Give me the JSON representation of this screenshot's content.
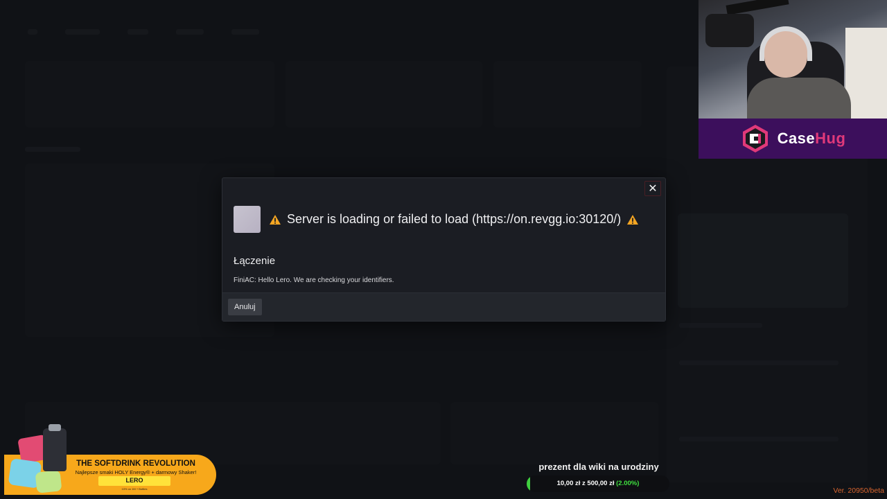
{
  "modal": {
    "title": "Server is loading or failed to load (https://on.revgg.io:30120/)",
    "close_symbol": "✕",
    "status": "Łączenie",
    "message": "FiniAC: Hello Lero. We are checking your identifiers.",
    "cancel_label": "Anuluj",
    "icons": {
      "warning": "warning-triangle-icon",
      "close": "close-icon"
    },
    "colors": {
      "warning": "#f5a623",
      "overlay_bg": "#1b1d23"
    }
  },
  "sponsor": {
    "name_part1": "Case",
    "name_part2": "Hug",
    "colors": {
      "background": "#3c0f5c",
      "accent": "#e0397a"
    }
  },
  "drink_ad": {
    "title": "THE SOFTDRINK REVOLUTION",
    "subtitle": "Najlepsze smaki HOLY Energy® + darmowy Shaker!",
    "code": "LERO",
    "fine_print": "10% on 1M + Bottles",
    "color": "#f7a81b"
  },
  "goal": {
    "title": "prezent dla wiki na urodziny",
    "amount_text": "10,00 zł z 500,00 zł",
    "percent_text": "(2.00%)",
    "progress": 0.02,
    "color": "#3fcf3f"
  },
  "version": "Ver. 20950/beta"
}
